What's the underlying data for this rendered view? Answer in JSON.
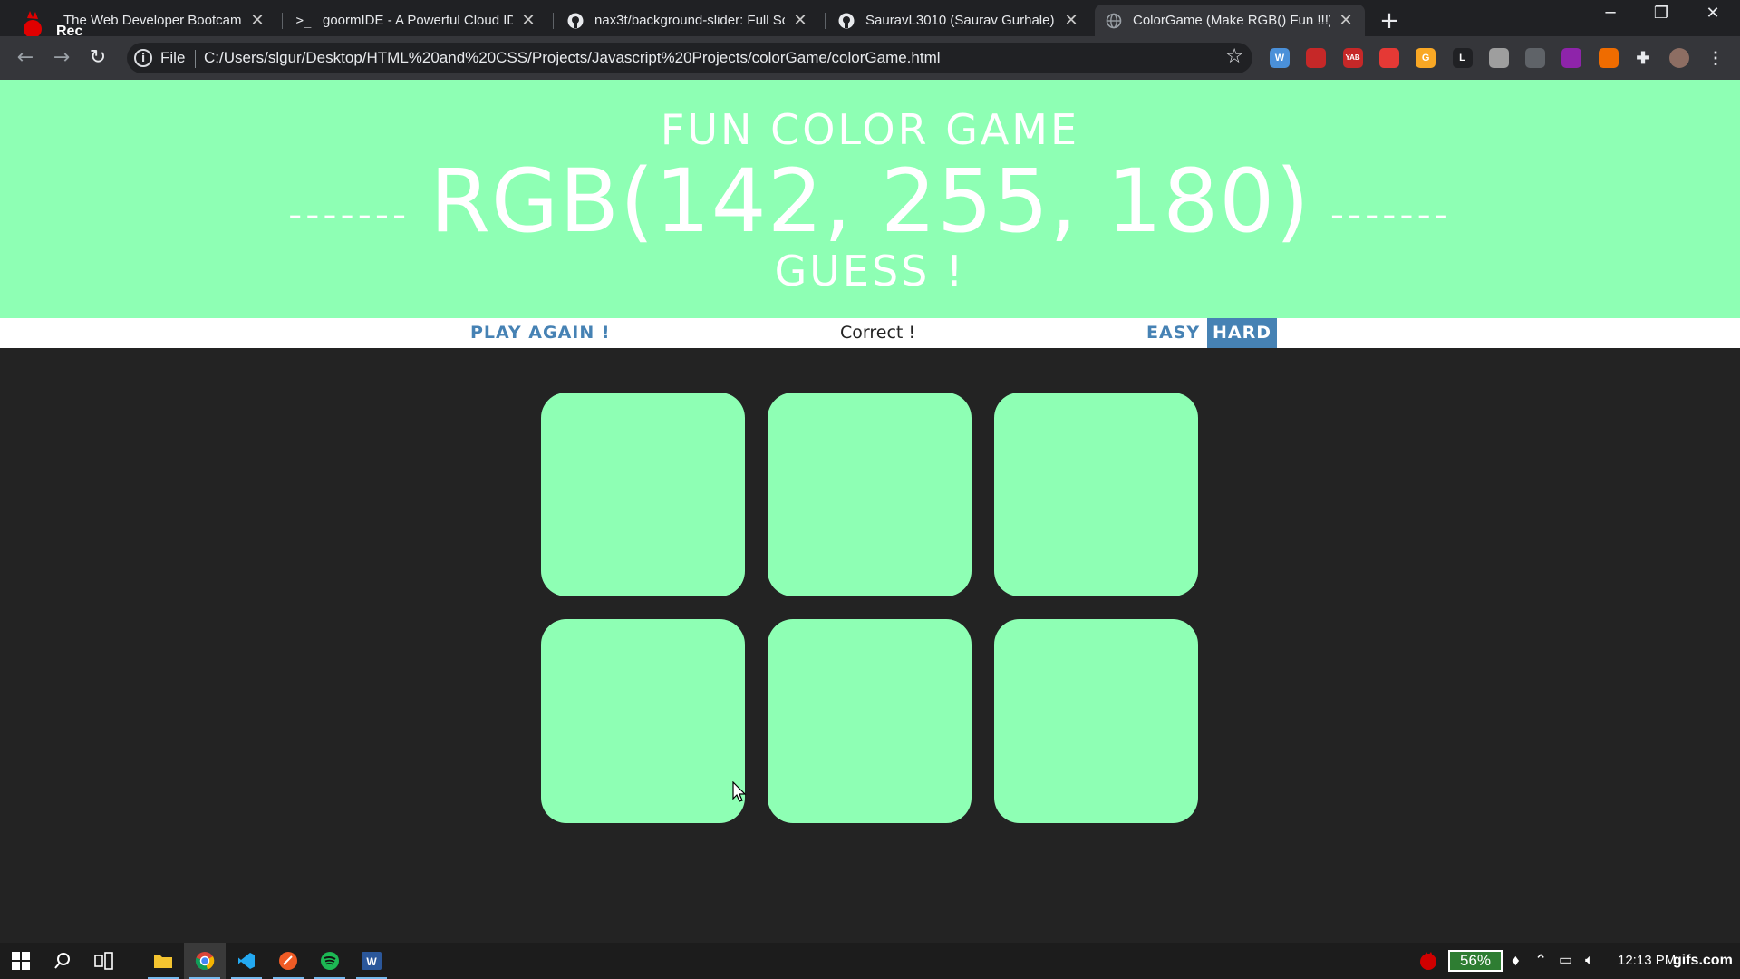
{
  "browser": {
    "recorder_label": "Rec",
    "tabs": [
      {
        "title": "The Web Developer Bootcamp | U",
        "active": false,
        "icon": "bootcamp-flame-icon"
      },
      {
        "title": "goormIDE - A Powerful Cloud IDE",
        "active": false,
        "icon": "terminal-prompt-icon"
      },
      {
        "title": "nax3t/background-slider: Full Sc",
        "active": false,
        "icon": "github-icon"
      },
      {
        "title": "SauravL3010 (Saurav Gurhale)",
        "active": false,
        "icon": "github-icon"
      },
      {
        "title": "ColorGame (Make RGB() Fun !!!)",
        "active": true,
        "icon": "globe-icon"
      }
    ],
    "new_tab_symbol": "+",
    "address": {
      "scheme_label": "File",
      "url": "C:/Users/slgur/Desktop/HTML%20and%20CSS/Projects/Javascript%20Projects/colorGame/colorGame.html"
    },
    "extensions": [
      {
        "icon": "w-extension-icon",
        "label": "W",
        "color": "#4a90d9"
      },
      {
        "icon": "pdf-extension-icon",
        "label": "",
        "color": "#c62828"
      },
      {
        "icon": "yab-extension-icon",
        "label": "YAB",
        "color": "#c62828"
      },
      {
        "icon": "hand-extension-icon",
        "label": "",
        "color": "#e53935"
      },
      {
        "icon": "g-extension-icon",
        "label": "G",
        "color": "#f9a825"
      },
      {
        "icon": "l-extension-icon",
        "label": "L",
        "color": "#202124"
      },
      {
        "icon": "circle-extension-icon",
        "label": "",
        "color": "#9e9e9e"
      },
      {
        "icon": "cloud-extension-icon",
        "label": "",
        "color": "#5f6368"
      },
      {
        "icon": "colorwheel-extension-icon",
        "label": "",
        "color": "#8e24aa"
      },
      {
        "icon": "orange-extension-icon",
        "label": "",
        "color": "#ef6c00"
      }
    ]
  },
  "game": {
    "title": "Fun Color Game",
    "dash_left": "-------",
    "rgb_display": "RGB(142, 255, 180)",
    "dash_right": "-------",
    "subtitle": "Guess !",
    "play_again_label": "Play Again !",
    "message": "Correct !",
    "easy_label": "Easy",
    "hard_label": "Hard",
    "selected_mode": "Hard",
    "square_colors": [
      "#8effb4",
      "#8effb4",
      "#8effb4",
      "#8effb4",
      "#8effb4",
      "#8effb4"
    ],
    "header_color": "#8effb4",
    "accent_color": "steelblue",
    "background_color": "#232323"
  },
  "taskbar": {
    "apps": [
      {
        "icon": "windows-start-icon"
      },
      {
        "icon": "search-icon"
      },
      {
        "icon": "task-view-icon"
      },
      {
        "icon": "file-explorer-icon",
        "open": true
      },
      {
        "icon": "chrome-icon",
        "open": true
      },
      {
        "icon": "vscode-icon",
        "open": true
      },
      {
        "icon": "postman-icon",
        "open": true
      },
      {
        "icon": "spotify-icon",
        "open": true
      },
      {
        "icon": "word-icon",
        "open": true
      }
    ],
    "battery_percent": "56%",
    "clock": "12:13 PM",
    "watermark": "gifs.com"
  }
}
